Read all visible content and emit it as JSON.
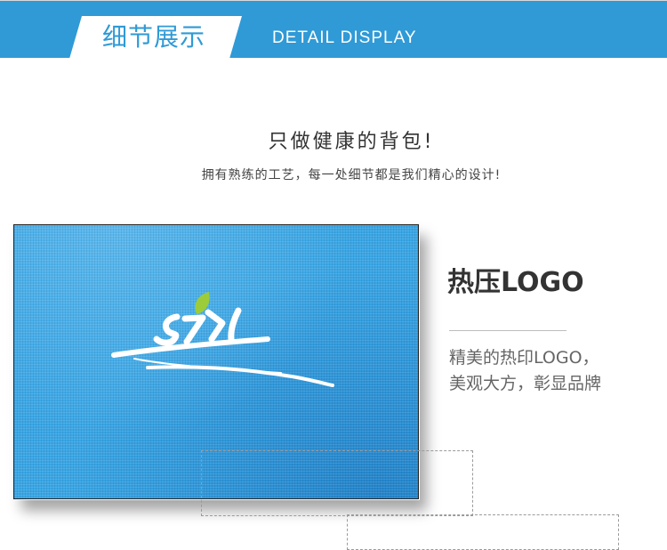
{
  "banner": {
    "title_cn": "细节展示",
    "title_en": "DETAIL DISPLAY",
    "color": "#2f9ad6"
  },
  "intro": {
    "headline": "只做健康的背包!",
    "subline": "拥有熟练的工艺，每一处细节都是我们精心的设计!"
  },
  "feature": {
    "title": "热压LOGO",
    "description_line1": "精美的热印LOGO，",
    "description_line2": "美观大方，彰显品牌"
  },
  "photo": {
    "subject": "blue-fabric-logo-closeup",
    "fabric_color": "#3aa6e4",
    "logo_color": "#ffffff",
    "leaf_color": "#9ccc3a"
  }
}
